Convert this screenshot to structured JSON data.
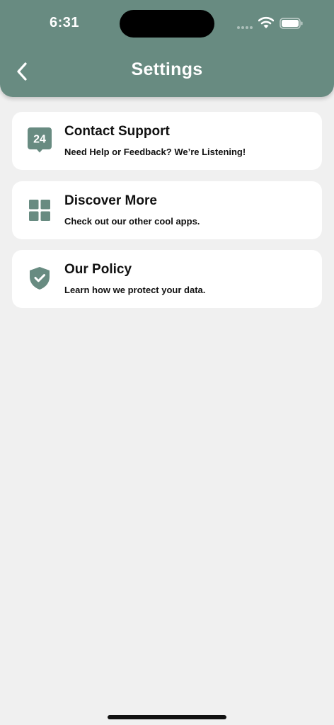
{
  "status_bar": {
    "time": "6:31"
  },
  "header": {
    "title": "Settings",
    "back_icon": "chevron-left-icon"
  },
  "colors": {
    "accent": "#688b81",
    "background": "#f0f0f0",
    "card": "#ffffff",
    "text": "#111111"
  },
  "items": [
    {
      "icon": "support-24-icon",
      "badge_text": "24",
      "title": "Contact Support",
      "subtitle": "Need Help or Feedback? We’re Listening!"
    },
    {
      "icon": "grid-icon",
      "title": "Discover More",
      "subtitle": "Check out our other cool apps."
    },
    {
      "icon": "shield-check-icon",
      "title": "Our Policy",
      "subtitle": "Learn how we protect your data."
    }
  ]
}
